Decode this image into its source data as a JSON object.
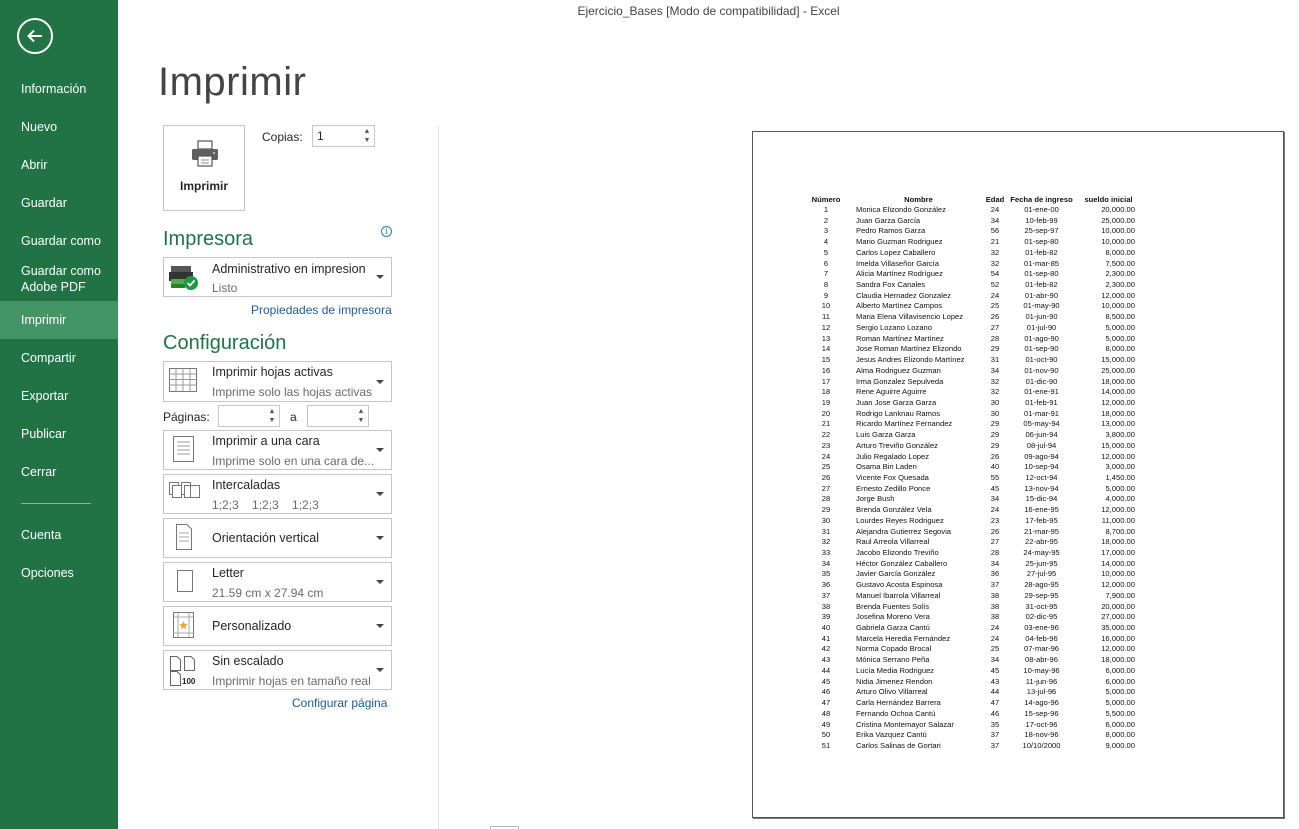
{
  "window": {
    "title": "Ejercicio_Bases  [Modo de compatibilidad] - Excel"
  },
  "sidebar": {
    "items": [
      {
        "label": "Información"
      },
      {
        "label": "Nuevo"
      },
      {
        "label": "Abrir"
      },
      {
        "label": "Guardar"
      },
      {
        "label": "Guardar como"
      },
      {
        "label": "Guardar como\nAdobe PDF"
      },
      {
        "label": "Imprimir"
      },
      {
        "label": "Compartir"
      },
      {
        "label": "Exportar"
      },
      {
        "label": "Publicar"
      },
      {
        "label": "Cerrar"
      },
      {
        "label": "Cuenta"
      },
      {
        "label": "Opciones"
      }
    ],
    "active": "Imprimir",
    "accent": "#217346",
    "active_bg": "#439467"
  },
  "print": {
    "page_title": "Imprimir",
    "print_button": "Imprimir",
    "copies_label": "Copias:",
    "copies_value": "1"
  },
  "printer": {
    "section": "Impresora",
    "name": "Administrativo en impresion",
    "status": "Listo",
    "properties_link": "Propiedades de impresora"
  },
  "settings": {
    "section": "Configuración",
    "what": {
      "main": "Imprimir hojas activas",
      "sub": "Imprime solo las hojas activas"
    },
    "pages_label": "Páginas:",
    "pages_to": "a",
    "sides": {
      "main": "Imprimir a una cara",
      "sub": "Imprime solo en una cara de..."
    },
    "collate": {
      "main": "Intercaladas",
      "sub": "1;2;3    1;2;3    1;2;3"
    },
    "orientation": {
      "main": "Orientación vertical"
    },
    "paper": {
      "main": "Letter",
      "sub": "21.59 cm x 27.94 cm"
    },
    "margins": {
      "main": "Personalizado"
    },
    "scaling": {
      "main": "Sin escalado",
      "sub": "Imprimir hojas en tamaño real",
      "icon_text": "100"
    },
    "page_setup_link": "Configurar página"
  },
  "preview": {
    "headers": [
      "Número",
      "Nombre",
      "Edad",
      "Fecha de ingreso",
      "sueldo inicial"
    ],
    "rows": [
      [
        "1",
        "Monica Elizondo González",
        "24",
        "01-ene-00",
        "20,000.00"
      ],
      [
        "2",
        "Juan Garza García",
        "34",
        "10-feb-99",
        "25,000.00"
      ],
      [
        "3",
        "Pedro Ramos Garza",
        "56",
        "25-sep-97",
        "10,000.00"
      ],
      [
        "4",
        "Mario Guzman Rodriguez",
        "21",
        "01-sep-80",
        "10,000.00"
      ],
      [
        "5",
        "Carlos Lopez Caballero",
        "32",
        "01-feb-82",
        "8,000.00"
      ],
      [
        "6",
        "Imelda Villaseñor García",
        "32",
        "01-mar-85",
        "7,500.00"
      ],
      [
        "7",
        "Alicia Martínez Rodríguez",
        "54",
        "01-sep-80",
        "2,300.00"
      ],
      [
        "8",
        "Sandra Fox Canales",
        "52",
        "01-feb-82",
        "2,300.00"
      ],
      [
        "9",
        "Claudia Hernadez Gonzalez",
        "24",
        "01-abr-90",
        "12,000.00"
      ],
      [
        "10",
        "Alberto Martínez Campos",
        "25",
        "01-may-90",
        "10,000.00"
      ],
      [
        "11",
        "Maria Elena Villavisencio Lopez",
        "26",
        "01-jun-90",
        "8,500.00"
      ],
      [
        "12",
        "Sergio Lozano Lozano",
        "27",
        "01-jul-90",
        "5,000.00"
      ],
      [
        "13",
        "Roman Martínez Martínez",
        "28",
        "01-ago-90",
        "5,000.00"
      ],
      [
        "14",
        "Jose Roman Martínez Elizondo",
        "29",
        "01-sep-90",
        "8,000.00"
      ],
      [
        "15",
        "Jesus Andres Elizondo Martínez",
        "31",
        "01-oct-90",
        "15,000.00"
      ],
      [
        "16",
        "Alma Rodriguez Guzman",
        "34",
        "01-nov-90",
        "25,000.00"
      ],
      [
        "17",
        "Irma Gonzalez Sepulveda",
        "32",
        "01-dic-90",
        "18,000.00"
      ],
      [
        "18",
        "Rene Aguirre Aguirre",
        "32",
        "01-ene-91",
        "14,000.00"
      ],
      [
        "19",
        "Juan Jose Garza Garza",
        "30",
        "01-feb-91",
        "12,000.00"
      ],
      [
        "20",
        "Rodrigo Lanknau Ramos",
        "30",
        "01-mar-91",
        "18,000.00"
      ],
      [
        "21",
        "Ricardo Martínez Fernandez",
        "29",
        "05-may-94",
        "13,000.00"
      ],
      [
        "22",
        "Luis Garza Garza",
        "29",
        "06-jun-94",
        "3,800.00"
      ],
      [
        "23",
        "Arturo Treviño González",
        "29",
        "08-jul-94",
        "15,000.00"
      ],
      [
        "24",
        "Julio Regalado Lopez",
        "26",
        "09-ago-94",
        "12,000.00"
      ],
      [
        "25",
        "Osama Bin Laden",
        "40",
        "10-sep-94",
        "3,000.00"
      ],
      [
        "26",
        "Vicente Fox Quesada",
        "55",
        "12-oct-94",
        "1,450.00"
      ],
      [
        "27",
        "Ernesto Zedillo Ponce",
        "45",
        "13-nov-94",
        "5,000.00"
      ],
      [
        "28",
        "Jorge Bush",
        "34",
        "15-dic-94",
        "4,000.00"
      ],
      [
        "29",
        "Brenda González Vela",
        "24",
        "16-ene-95",
        "12,000.00"
      ],
      [
        "30",
        "Lourdes Reyes Rodriguez",
        "23",
        "17-feb-95",
        "11,000.00"
      ],
      [
        "31",
        "Alejandra Gutierrez Segovia",
        "26",
        "21-mar-95",
        "8,700.00"
      ],
      [
        "32",
        "Raul Arreola Villarreal",
        "27",
        "22-abr-95",
        "18,000.00"
      ],
      [
        "33",
        "Jacobo Elizondo Treviño",
        "28",
        "24-may-95",
        "17,000.00"
      ],
      [
        "34",
        "Héctor González Caballero",
        "34",
        "25-jun-95",
        "14,000.00"
      ],
      [
        "35",
        "Javier García González",
        "36",
        "27-jul-95",
        "10,000.00"
      ],
      [
        "36",
        "Gustavo Acosta Espinosa",
        "37",
        "28-ago-95",
        "12,000.00"
      ],
      [
        "37",
        "Manuel Ibarrola Villarreal",
        "38",
        "29-sep-95",
        "7,900.00"
      ],
      [
        "38",
        "Brenda Fuentes Solís",
        "38",
        "31-oct-95",
        "20,000.00"
      ],
      [
        "39",
        "Josefina Moreno Vera",
        "38",
        "02-dic-95",
        "27,000.00"
      ],
      [
        "40",
        "Gabriela Garza Cantú",
        "24",
        "03-ene-96",
        "35,000.00"
      ],
      [
        "41",
        "Marcela Heredia Fernández",
        "24",
        "04-feb-96",
        "16,000.00"
      ],
      [
        "42",
        "Norma Copado Brocal",
        "25",
        "07-mar-96",
        "12,000.00"
      ],
      [
        "43",
        "Mónica Serrano Peña",
        "34",
        "08-abr-96",
        "18,000.00"
      ],
      [
        "44",
        "Lucía Media Rodriguez",
        "45",
        "10-may-96",
        "6,000.00"
      ],
      [
        "45",
        "Nidia Jimenez Rendon",
        "43",
        "11-jun-96",
        "6,000.00"
      ],
      [
        "46",
        "Arturo Olivo Villarreal",
        "44",
        "13-jul-96",
        "5,000.00"
      ],
      [
        "47",
        "Carla Hernández Barrera",
        "47",
        "14-ago-96",
        "5,000.00"
      ],
      [
        "48",
        "Fernando Ochoa Cantú",
        "46",
        "15-sep-96",
        "5,500.00"
      ],
      [
        "49",
        "Cristina Montemayor Salazar",
        "35",
        "17-oct-96",
        "6,000.00"
      ],
      [
        "50",
        "Erika Vazquez Cantú",
        "37",
        "18-nov-96",
        "8,000.00"
      ],
      [
        "51",
        "Carlos Salinas de Gortari",
        "37",
        "10/10/2000",
        "9,000.00"
      ]
    ]
  }
}
